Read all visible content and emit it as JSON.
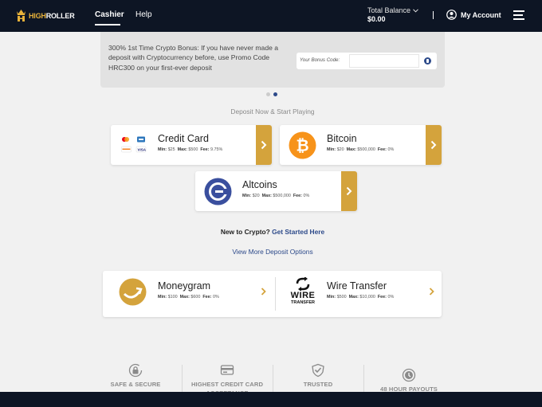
{
  "header": {
    "logo_text_gold": "HIGH",
    "logo_text_white": "ROLLER",
    "nav": {
      "cashier": "Cashier",
      "help": "Help"
    },
    "balance_label": "Total Balance",
    "balance_value": "$0.00",
    "account_label": "My Account"
  },
  "promo": {
    "text": "300% 1st Time Crypto Bonus: If you have never made a deposit with Cryptocurrency before, use Promo Code HRC300 on your first-ever deposit",
    "code_label": "Your Bonus Code:",
    "code_value": "",
    "carousel_count": 2,
    "carousel_active": 2
  },
  "deposit": {
    "heading": "Deposit Now & Start Playing",
    "methods": [
      {
        "name": "Credit Card",
        "min_label": "Min:",
        "min": "$25",
        "max_label": "Max:",
        "max": "$500",
        "fee_label": "Fee:",
        "fee": "9.75%",
        "icon": "credit-card-logos"
      },
      {
        "name": "Bitcoin",
        "min_label": "Min:",
        "min": "$20",
        "max_label": "Max:",
        "max": "$500,000",
        "fee_label": "Fee:",
        "fee": "0%",
        "icon": "bitcoin-icon"
      },
      {
        "name": "Altcoins",
        "min_label": "Min:",
        "min": "$20",
        "max_label": "Max:",
        "max": "$500,000",
        "fee_label": "Fee:",
        "fee": "0%",
        "icon": "altcoins-icon"
      }
    ],
    "new_to_crypto": "New to Crypto?",
    "get_started": "Get Started Here",
    "more_options": "View More Deposit Options",
    "other_methods": [
      {
        "name": "Moneygram",
        "min_label": "Min:",
        "min": "$100",
        "max_label": "Max:",
        "max": "$600",
        "fee_label": "Fee:",
        "fee": "0%",
        "icon": "moneygram-icon"
      },
      {
        "name": "Wire Transfer",
        "min_label": "Min:",
        "min": "$500",
        "max_label": "Max:",
        "max": "$10,000",
        "fee_label": "Fee:",
        "fee": "0%",
        "icon": "wire-transfer-icon",
        "logo_line1": "WIRE",
        "logo_line2": "TRANSFER"
      }
    ]
  },
  "trust": {
    "items": [
      {
        "label": "SAFE & SECURE",
        "icon": "lock-icon"
      },
      {
        "label": "HIGHEST CREDIT CARD ACCEPTANCE",
        "icon": "credit-card-icon"
      },
      {
        "label": "TRUSTED",
        "icon": "shield-check-icon"
      },
      {
        "label": "48 HOUR PAYOUTS",
        "icon": "clock-icon"
      }
    ]
  },
  "colors": {
    "navy": "#0d1524",
    "gold": "#d4a33c",
    "link_blue": "#2d4a8a",
    "bitcoin_orange": "#f7931a"
  }
}
